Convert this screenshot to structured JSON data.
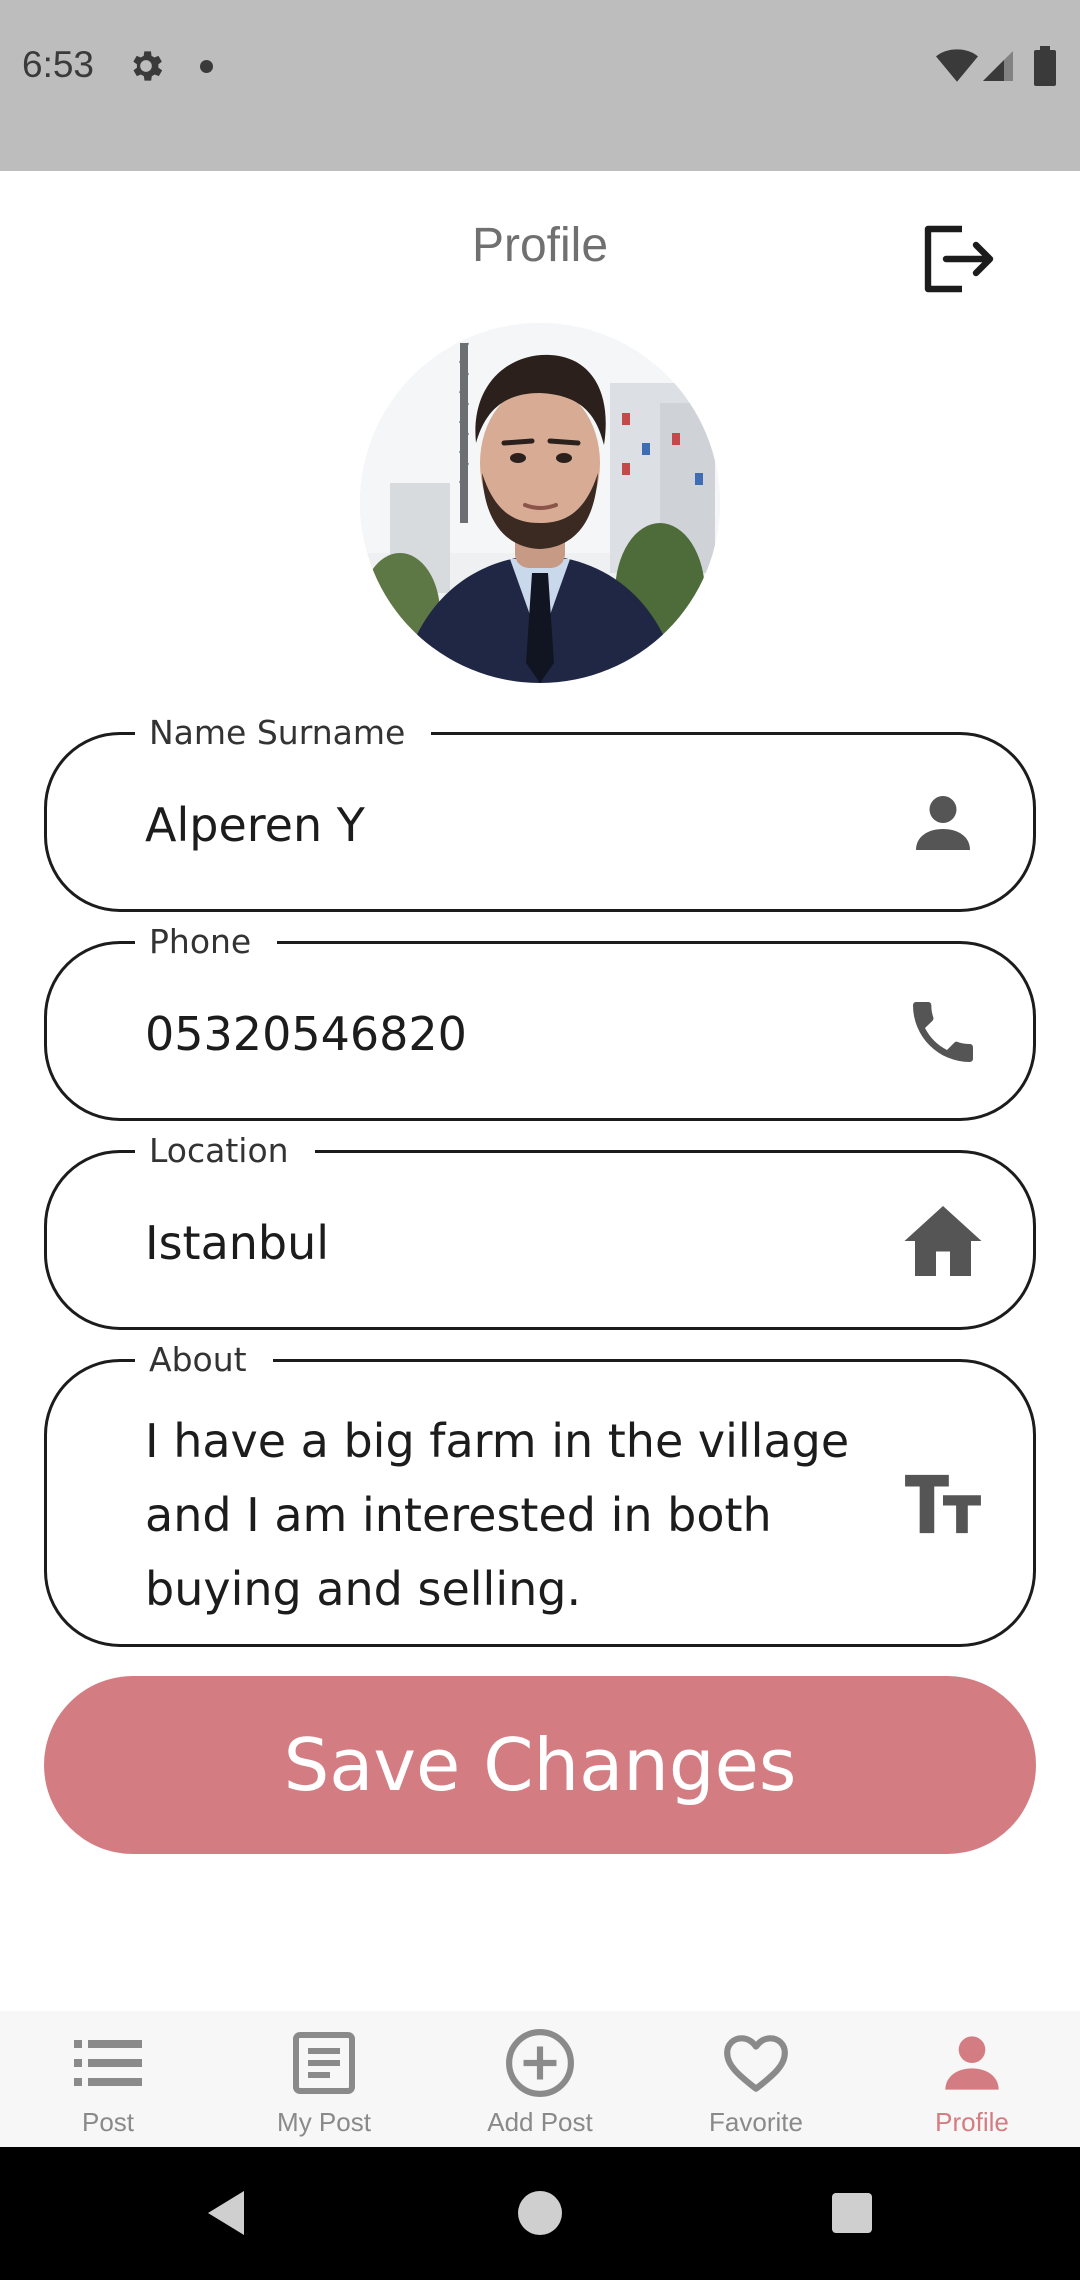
{
  "status_bar": {
    "time": "6:53",
    "icons": [
      "gear-icon",
      "notification-dot-icon",
      "wifi-icon",
      "signal-icon",
      "battery-icon"
    ]
  },
  "header": {
    "title": "Profile",
    "logout_icon": "logout-icon"
  },
  "profile": {
    "avatar_icon": "profile-photo"
  },
  "fields": {
    "name": {
      "label": "Name Surname",
      "value": "Alperen Y",
      "icon": "person-icon"
    },
    "phone": {
      "label": "Phone",
      "value": "05320546820",
      "icon": "phone-icon"
    },
    "location": {
      "label": "Location",
      "value": "Istanbul",
      "icon": "home-icon"
    },
    "about": {
      "label": "About",
      "lines": [
        "I have a big farm in the village",
        "and I am interested in both",
        "buying and selling."
      ],
      "icon": "text-size-icon"
    }
  },
  "save_button": {
    "label": "Save Changes"
  },
  "bottom_nav": {
    "items": [
      {
        "label": "Post",
        "icon": "list-icon"
      },
      {
        "label": "My Post",
        "icon": "document-icon"
      },
      {
        "label": "Add Post",
        "icon": "add-circle-icon"
      },
      {
        "label": "Favorite",
        "icon": "heart-icon"
      },
      {
        "label": "Profile",
        "icon": "person-icon"
      }
    ],
    "active_index": 4
  },
  "colors": {
    "accent": "#d37d83",
    "status_bar": "#bdbdbd",
    "text": "#1c1c1c",
    "nav_inactive": "#8a8a8a",
    "nav_background": "#f7f7f7"
  }
}
